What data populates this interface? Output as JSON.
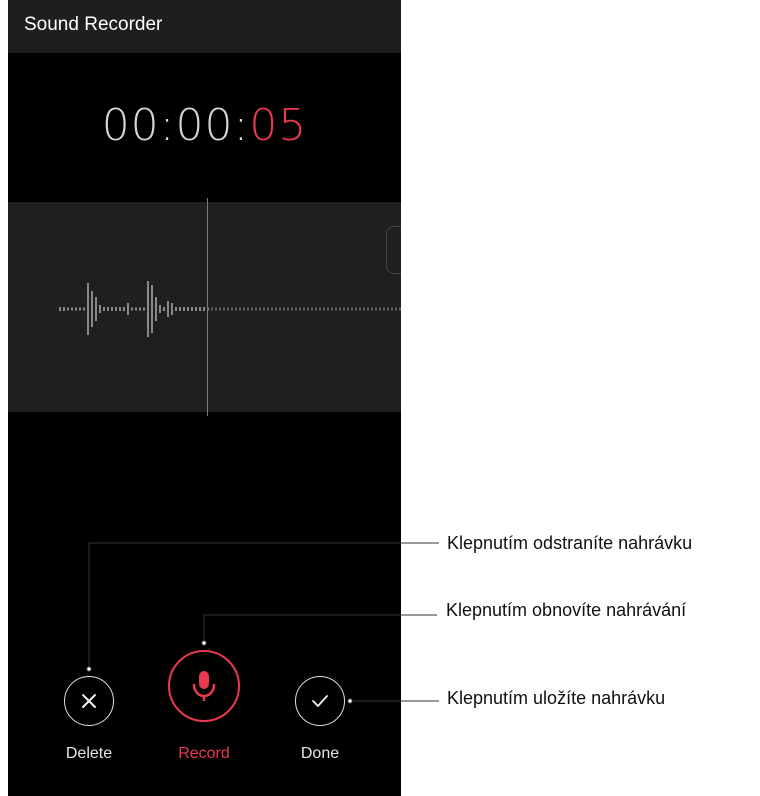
{
  "app": {
    "title": "Sound Recorder"
  },
  "timer": {
    "prefix": "00:00:",
    "seconds": "05"
  },
  "controls": {
    "delete_label": "Delete",
    "record_label": "Record",
    "done_label": "Done"
  },
  "callouts": {
    "delete": "Klepnutím odstraníte nahrávku",
    "record": "Klepnutím obnovíte nahrávání",
    "done": "Klepnutím uložíte nahrávku"
  },
  "icons": {
    "delete": "close-icon",
    "record": "microphone-icon",
    "done": "checkmark-icon"
  },
  "colors": {
    "accent": "#e8394f",
    "background": "#000000",
    "panel": "#1f1f1f",
    "text": "#e6e6e6"
  }
}
